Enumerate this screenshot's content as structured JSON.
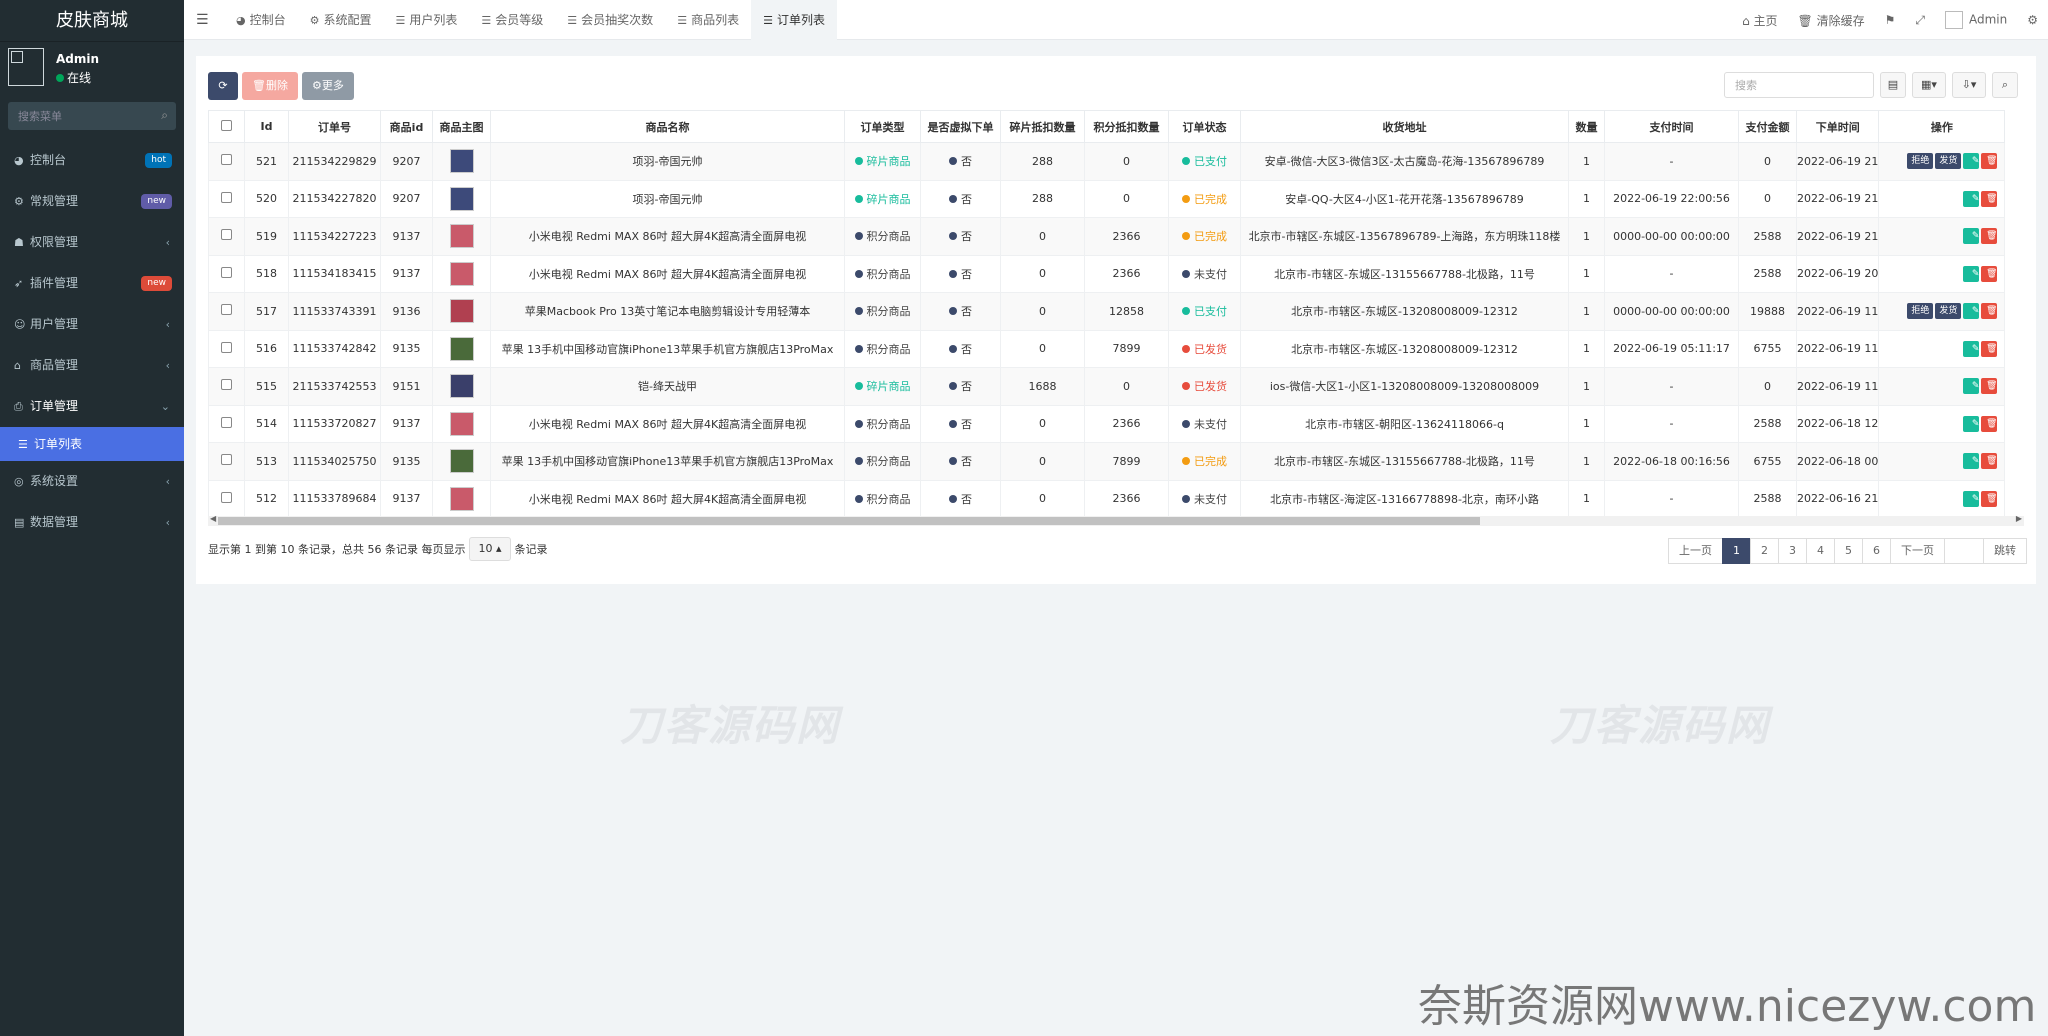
{
  "sidebar": {
    "logo": "皮肤商城",
    "user": {
      "name": "Admin",
      "status": "在线"
    },
    "search_placeholder": "搜索菜单",
    "menu": [
      {
        "icon": "dashboard-icon",
        "glyph": "◕",
        "label": "控制台",
        "badge": "hot",
        "badge_color": "#0073b7"
      },
      {
        "icon": "gears-icon",
        "glyph": "⚙",
        "label": "常规管理",
        "badge": "new",
        "badge_color": "#605ca8"
      },
      {
        "icon": "users-icon",
        "glyph": "☗",
        "label": "权限管理",
        "caret": "‹"
      },
      {
        "icon": "rocket-icon",
        "glyph": "➶",
        "label": "插件管理",
        "badge": "new",
        "badge_color": "#dd4b39"
      },
      {
        "icon": "user-circle-icon",
        "glyph": "☺",
        "label": "用户管理",
        "caret": "‹"
      },
      {
        "icon": "bank-icon",
        "glyph": "⌂",
        "label": "商品管理",
        "caret": "‹"
      },
      {
        "icon": "print-icon",
        "glyph": "⎙",
        "label": "订单管理",
        "caret": "⌄",
        "open": true
      },
      {
        "icon": "list-icon",
        "glyph": "☰",
        "label": "订单列表",
        "active": true
      },
      {
        "icon": "settings-icon",
        "glyph": "◎",
        "label": "系统设置",
        "caret": "‹"
      },
      {
        "icon": "database-icon",
        "glyph": "▤",
        "label": "数据管理",
        "caret": "‹"
      }
    ]
  },
  "topbar": {
    "tabs": [
      {
        "glyph": "◕",
        "label": "控制台"
      },
      {
        "glyph": "⚙",
        "label": "系统配置"
      },
      {
        "glyph": "☰",
        "label": "用户列表"
      },
      {
        "glyph": "☰",
        "label": "会员等级"
      },
      {
        "glyph": "☰",
        "label": "会员抽奖次数"
      },
      {
        "glyph": "☰",
        "label": "商品列表"
      },
      {
        "glyph": "☰",
        "label": "订单列表",
        "active": true
      }
    ],
    "home": "主页",
    "clear_cache": "清除缓存",
    "admin": "Admin"
  },
  "toolbar": {
    "refresh_glyph": "⟳",
    "delete_label": "删除",
    "more_label": "更多",
    "search_placeholder": "搜索"
  },
  "table": {
    "columns": [
      "Id",
      "订单号",
      "商品id",
      "商品主图",
      "商品名称",
      "订单类型",
      "是否虚拟下单",
      "碎片抵扣数量",
      "积分抵扣数量",
      "订单状态",
      "收货地址",
      "数量",
      "支付时间",
      "支付金额",
      "下单时间",
      "操作"
    ],
    "rows": [
      {
        "id": "521",
        "order_no": "211534229829",
        "goods_id": "9207",
        "thumb": "#3d4a7a",
        "name": "项羽-帝国元帅",
        "type": "碎片商品",
        "type_color": "green",
        "virtual": "否",
        "frag": "288",
        "points": "0",
        "status": "已支付",
        "status_color": "green",
        "address": "安卓-微信-大区3-微信3区-太古魔岛-花海-13567896789",
        "qty": "1",
        "pay_time": "-",
        "amount": "0",
        "order_time": "2022-06-19 21",
        "actions": [
          "拒绝",
          "发货"
        ]
      },
      {
        "id": "520",
        "order_no": "211534227820",
        "goods_id": "9207",
        "thumb": "#3d4a7a",
        "name": "项羽-帝国元帅",
        "type": "碎片商品",
        "type_color": "green",
        "virtual": "否",
        "frag": "288",
        "points": "0",
        "status": "已完成",
        "status_color": "orange",
        "address": "安卓-QQ-大区4-小区1-花开花落-13567896789",
        "qty": "1",
        "pay_time": "2022-06-19 22:00:56",
        "amount": "0",
        "order_time": "2022-06-19 21",
        "actions": []
      },
      {
        "id": "519",
        "order_no": "111534227223",
        "goods_id": "9137",
        "thumb": "#c95a6a",
        "name": "小米电视 Redmi MAX 86吋 超大屏4K超高清全面屏电视",
        "type": "积分商品",
        "type_color": "dark",
        "virtual": "否",
        "frag": "0",
        "points": "2366",
        "status": "已完成",
        "status_color": "orange",
        "address": "北京市-市辖区-东城区-13567896789-上海路，东方明珠118楼",
        "qty": "1",
        "pay_time": "0000-00-00 00:00:00",
        "amount": "2588",
        "order_time": "2022-06-19 21",
        "actions": []
      },
      {
        "id": "518",
        "order_no": "111534183415",
        "goods_id": "9137",
        "thumb": "#c95a6a",
        "name": "小米电视 Redmi MAX 86吋 超大屏4K超高清全面屏电视",
        "type": "积分商品",
        "type_color": "dark",
        "virtual": "否",
        "frag": "0",
        "points": "2366",
        "status": "未支付",
        "status_color": "dark",
        "address": "北京市-市辖区-东城区-13155667788-北极路，11号",
        "qty": "1",
        "pay_time": "-",
        "amount": "2588",
        "order_time": "2022-06-19 20",
        "actions": []
      },
      {
        "id": "517",
        "order_no": "111533743391",
        "goods_id": "9136",
        "thumb": "#b04050",
        "name": "苹果Macbook Pro 13英寸笔记本电脑剪辑设计专用轻薄本",
        "type": "积分商品",
        "type_color": "dark",
        "virtual": "否",
        "frag": "0",
        "points": "12858",
        "status": "已支付",
        "status_color": "green",
        "address": "北京市-市辖区-东城区-13208008009-12312",
        "qty": "1",
        "pay_time": "0000-00-00 00:00:00",
        "amount": "19888",
        "order_time": "2022-06-19 11",
        "actions": [
          "拒绝",
          "发货"
        ]
      },
      {
        "id": "516",
        "order_no": "111533742842",
        "goods_id": "9135",
        "thumb": "#4a6a3a",
        "name": "苹果 13手机中国移动官旗iPhone13苹果手机官方旗舰店13ProMax",
        "type": "积分商品",
        "type_color": "dark",
        "virtual": "否",
        "frag": "0",
        "points": "7899",
        "status": "已发货",
        "status_color": "red",
        "address": "北京市-市辖区-东城区-13208008009-12312",
        "qty": "1",
        "pay_time": "2022-06-19 05:11:17",
        "amount": "6755",
        "order_time": "2022-06-19 11",
        "actions": []
      },
      {
        "id": "515",
        "order_no": "211533742553",
        "goods_id": "9151",
        "thumb": "#3a3f6a",
        "name": "铠-绛天战甲",
        "type": "碎片商品",
        "type_color": "green",
        "virtual": "否",
        "frag": "1688",
        "points": "0",
        "status": "已发货",
        "status_color": "red",
        "address": "ios-微信-大区1-小区1-13208008009-13208008009",
        "qty": "1",
        "pay_time": "-",
        "amount": "0",
        "order_time": "2022-06-19 11",
        "actions": []
      },
      {
        "id": "514",
        "order_no": "111533720827",
        "goods_id": "9137",
        "thumb": "#c95a6a",
        "name": "小米电视 Redmi MAX 86吋 超大屏4K超高清全面屏电视",
        "type": "积分商品",
        "type_color": "dark",
        "virtual": "否",
        "frag": "0",
        "points": "2366",
        "status": "未支付",
        "status_color": "dark",
        "address": "北京市-市辖区-朝阳区-13624118066-q",
        "qty": "1",
        "pay_time": "-",
        "amount": "2588",
        "order_time": "2022-06-18 12",
        "actions": []
      },
      {
        "id": "513",
        "order_no": "111534025750",
        "goods_id": "9135",
        "thumb": "#4a6a3a",
        "name": "苹果 13手机中国移动官旗iPhone13苹果手机官方旗舰店13ProMax",
        "type": "积分商品",
        "type_color": "dark",
        "virtual": "否",
        "frag": "0",
        "points": "7899",
        "status": "已完成",
        "status_color": "orange",
        "address": "北京市-市辖区-东城区-13155667788-北极路，11号",
        "qty": "1",
        "pay_time": "2022-06-18 00:16:56",
        "amount": "6755",
        "order_time": "2022-06-18 00",
        "actions": []
      },
      {
        "id": "512",
        "order_no": "111533789684",
        "goods_id": "9137",
        "thumb": "#c95a6a",
        "name": "小米电视 Redmi MAX 86吋 超大屏4K超高清全面屏电视",
        "type": "积分商品",
        "type_color": "dark",
        "virtual": "否",
        "frag": "0",
        "points": "2366",
        "status": "未支付",
        "status_color": "dark",
        "address": "北京市-市辖区-海淀区-13166778898-北京，南环小路",
        "qty": "1",
        "pay_time": "-",
        "amount": "2588",
        "order_time": "2022-06-16 21",
        "actions": []
      }
    ]
  },
  "pager": {
    "info_prefix": "显示第 1 到第 10 条记录，总共 56 条记录 每页显示",
    "page_size": "10",
    "info_suffix": "条记录",
    "prev": "上一页",
    "pages": [
      "1",
      "2",
      "3",
      "4",
      "5",
      "6"
    ],
    "current": "1",
    "next": "下一页",
    "jump": "跳转"
  },
  "watermarks": [
    "刀客源码网",
    "刀客源码网",
    "奈斯资源网www.nicezyw.com"
  ]
}
